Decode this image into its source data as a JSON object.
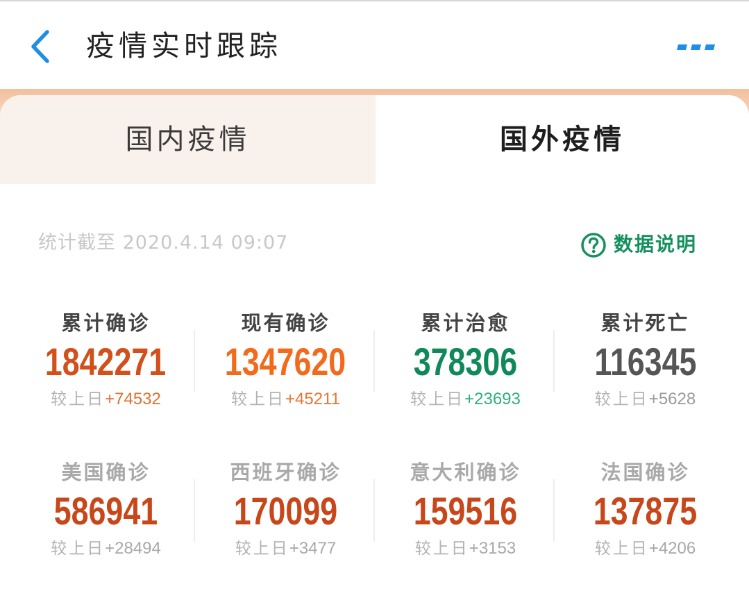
{
  "header": {
    "title": "疫情实时跟踪",
    "back_icon": "chevron-left-icon",
    "more_icon": "more-icon"
  },
  "tabs": [
    {
      "label": "国内疫情",
      "active": false
    },
    {
      "label": "国外疫情",
      "active": true
    }
  ],
  "stats_time": "统计截至 2020.4.14 09:07",
  "data_info": {
    "label": "数据说明",
    "icon": "question-circle-icon"
  },
  "stats": [
    {
      "label": "累计确诊",
      "value": "1842271",
      "compare_label": "较上日",
      "delta": "+74532",
      "label_color": "#444444",
      "value_color": "#d1501b",
      "delta_color": "#e0702e"
    },
    {
      "label": "现有确诊",
      "value": "1347620",
      "compare_label": "较上日",
      "delta": "+45211",
      "label_color": "#444444",
      "value_color": "#f26a1c",
      "delta_color": "#ea7430"
    },
    {
      "label": "累计治愈",
      "value": "378306",
      "compare_label": "较上日",
      "delta": "+23693",
      "label_color": "#444444",
      "value_color": "#10895a",
      "delta_color": "#2bb07c"
    },
    {
      "label": "累计死亡",
      "value": "116345",
      "compare_label": "较上日",
      "delta": "+5628",
      "label_color": "#444444",
      "value_color": "#555555",
      "delta_color": "#9b9b9b"
    },
    {
      "label": "美国确诊",
      "value": "586941",
      "compare_label": "较上日",
      "delta": "+28494",
      "label_color": "#a9a9a9",
      "value_color": "#c8471a",
      "delta_color": "#a8a8a8"
    },
    {
      "label": "西班牙确诊",
      "value": "170099",
      "compare_label": "较上日",
      "delta": "+3477",
      "label_color": "#a9a9a9",
      "value_color": "#c8471a",
      "delta_color": "#a8a8a8"
    },
    {
      "label": "意大利确诊",
      "value": "159516",
      "compare_label": "较上日",
      "delta": "+3153",
      "label_color": "#a9a9a9",
      "value_color": "#c8471a",
      "delta_color": "#a8a8a8"
    },
    {
      "label": "法国确诊",
      "value": "137875",
      "compare_label": "较上日",
      "delta": "+4206",
      "label_color": "#a9a9a9",
      "value_color": "#c8471a",
      "delta_color": "#a8a8a8"
    }
  ],
  "colors": {
    "accent_blue": "#1f8ee3",
    "info_green": "#16905e",
    "header_band": "#f2c09c",
    "inactive_tab_bg": "#f9f1ec"
  }
}
